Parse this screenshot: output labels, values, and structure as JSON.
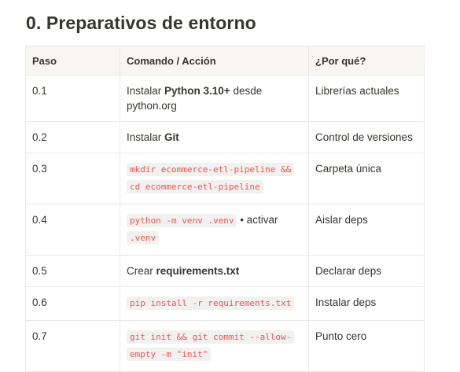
{
  "section": {
    "title": "0. Preparativos de entorno"
  },
  "table": {
    "headers": {
      "step": "Paso",
      "command": "Comando / Acción",
      "why": "¿Por qué?"
    },
    "rows": [
      {
        "step": "0.1",
        "cmd_pre": "Instalar ",
        "cmd_bold": "Python 3.10+",
        "cmd_post": " desde python.org",
        "why": "Librerías actuales"
      },
      {
        "step": "0.2",
        "cmd_pre": "Instalar ",
        "cmd_bold": "Git",
        "why": "Control de versiones"
      },
      {
        "step": "0.3",
        "code_a": "mkdir ecommerce-etl-pipeline &&",
        "code_b": "cd ecommerce-etl-pipeline",
        "why": "Carpeta única"
      },
      {
        "step": "0.4",
        "code_a": "python -m venv .venv",
        "cmd_post": " • activar",
        "code_b": ".venv",
        "why": "Aislar deps"
      },
      {
        "step": "0.5",
        "cmd_pre": "Crear ",
        "cmd_bold": "requirements.txt",
        "why": "Declarar deps"
      },
      {
        "step": "0.6",
        "code_a": "pip install -r requirements.txt",
        "why": "Instalar deps"
      },
      {
        "step": "0.7",
        "code_a": "git init && git commit --allow-",
        "code_b": "empty -m \"init\"",
        "why": "Punto cero"
      }
    ]
  },
  "colors": {
    "code_text": "#eb5757",
    "code_bg": "#f1f1ef",
    "header_bg": "#f7f6f3",
    "border": "#e9e9e7",
    "text": "#37352f"
  }
}
